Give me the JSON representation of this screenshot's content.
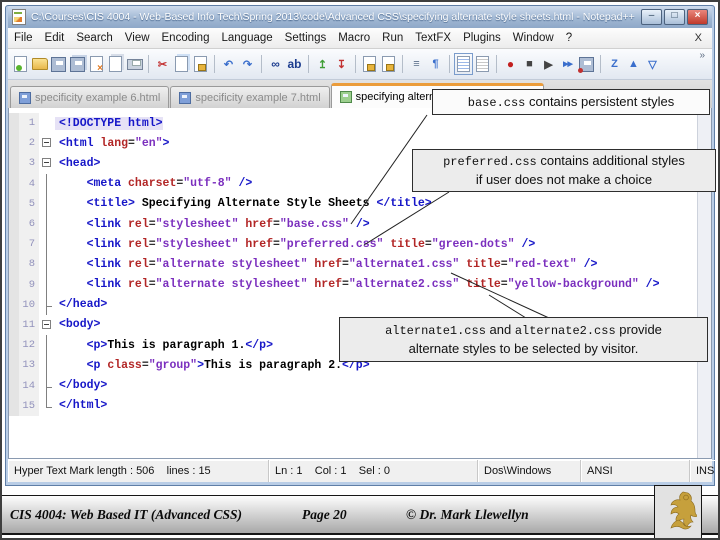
{
  "window": {
    "title": "C:\\Courses\\CIS 4004 - Web-Based Info Tech\\Spring 2013\\code\\Advanced CSS\\specifying alternate style sheets.html - Notepad++",
    "minimize": "–",
    "maximize": "□",
    "close": "×"
  },
  "menu": {
    "items": [
      "File",
      "Edit",
      "Search",
      "View",
      "Encoding",
      "Language",
      "Settings",
      "Macro",
      "Run",
      "TextFX",
      "Plugins",
      "Window",
      "?"
    ],
    "right_close": "X"
  },
  "toolbar": {
    "overflow": "»",
    "icons": [
      {
        "name": "new-file-icon",
        "cls": "i-page i-page-new"
      },
      {
        "name": "open-file-icon",
        "cls": "i-folder"
      },
      {
        "name": "save-icon",
        "cls": "i-disk"
      },
      {
        "name": "save-all-icon",
        "cls": "i-disk i-disk-all"
      },
      {
        "name": "close-file-icon",
        "cls": "i-page i-page-close"
      },
      {
        "name": "close-all-icon",
        "cls": "i-page i-page-close-all"
      },
      {
        "name": "print-icon",
        "cls": "i-print"
      },
      {
        "sep": true
      },
      {
        "name": "cut-icon",
        "cls": "i-glyph i-red",
        "glyph": "✂"
      },
      {
        "name": "copy-icon",
        "cls": "i-page i-page-copy"
      },
      {
        "name": "paste-icon",
        "cls": "i-page i-page-lock"
      },
      {
        "sep": true
      },
      {
        "name": "undo-icon",
        "cls": "i-glyph i-blue",
        "glyph": "↶"
      },
      {
        "name": "redo-icon",
        "cls": "i-glyph i-blue",
        "glyph": "↷"
      },
      {
        "sep": true
      },
      {
        "name": "find-icon",
        "cls": "i-glyph i-navy",
        "glyph": "∞"
      },
      {
        "name": "replace-icon",
        "cls": "i-glyph i-navy",
        "glyph": "ab"
      },
      {
        "sep": true
      },
      {
        "name": "prev-bookmark-icon",
        "cls": "i-glyph i-green",
        "glyph": "↥"
      },
      {
        "name": "next-bookmark-icon",
        "cls": "i-glyph i-red",
        "glyph": "↧"
      },
      {
        "sep": true
      },
      {
        "name": "readonly-doc-icon",
        "cls": "i-page i-page-lock"
      },
      {
        "name": "sync-scroll-icon",
        "cls": "i-page i-page-lock"
      },
      {
        "sep": true
      },
      {
        "name": "word-wrap-icon",
        "cls": "i-glyph i-slate",
        "glyph": "≡"
      },
      {
        "name": "show-symbols-icon",
        "cls": "i-glyph i-blue",
        "glyph": "¶"
      },
      {
        "sep": true
      },
      {
        "name": "document-map-icon",
        "cls": "i-page i-page-map i-selected"
      },
      {
        "name": "function-list-icon",
        "cls": "i-page i-page-func"
      },
      {
        "sep": true
      },
      {
        "name": "record-macro-icon",
        "cls": "i-glyph i-record",
        "glyph": "●"
      },
      {
        "name": "stop-macro-icon",
        "cls": "i-glyph i-dark",
        "glyph": "■"
      },
      {
        "name": "play-macro-icon",
        "cls": "i-glyph i-dark",
        "glyph": "▶"
      },
      {
        "name": "run-macro-multiple-icon",
        "cls": "i-glyph i-ff",
        "glyph": "▶▶"
      },
      {
        "name": "save-macro-icon",
        "cls": "i-disk i-disk-macro"
      },
      {
        "sep": true
      },
      {
        "name": "sort-icon",
        "cls": "i-glyph i-blue",
        "glyph": "Z"
      },
      {
        "name": "expand-icon",
        "cls": "i-glyph i-blue",
        "glyph": "▲"
      },
      {
        "name": "collapse-icon",
        "cls": "i-glyph i-blue",
        "glyph": "▽"
      }
    ]
  },
  "tabs": [
    {
      "label": "specificity example 6.html",
      "active": false
    },
    {
      "label": "specificity example 7.html",
      "active": false
    },
    {
      "label": "specifying alternate style sheets.html",
      "active": true
    }
  ],
  "editor": {
    "lines": [
      {
        "n": "1",
        "fold": "",
        "hl": true,
        "segs": [
          [
            "tag",
            "<!DOCTYPE html>"
          ]
        ]
      },
      {
        "n": "2",
        "fold": "box",
        "segs": [
          [
            "tag",
            "<html "
          ],
          [
            "attr",
            "lang"
          ],
          [
            "eq",
            "="
          ],
          [
            "val",
            "\"en\""
          ],
          [
            "tag",
            ">"
          ]
        ]
      },
      {
        "n": "3",
        "fold": "box",
        "segs": [
          [
            "tag",
            "<head>"
          ]
        ]
      },
      {
        "n": "4",
        "fold": "line",
        "segs": [
          [
            "pln",
            "    "
          ],
          [
            "tag",
            "<meta "
          ],
          [
            "attr",
            "charset"
          ],
          [
            "eq",
            "="
          ],
          [
            "val",
            "\"utf-8\""
          ],
          [
            "tag",
            " />"
          ]
        ]
      },
      {
        "n": "5",
        "fold": "line",
        "segs": [
          [
            "pln",
            "    "
          ],
          [
            "tag",
            "<title>"
          ],
          [
            "txt",
            " Specifying Alternate Style Sheets "
          ],
          [
            "tag",
            "</title>"
          ]
        ]
      },
      {
        "n": "6",
        "fold": "line",
        "segs": [
          [
            "pln",
            "    "
          ],
          [
            "tag",
            "<link "
          ],
          [
            "attr",
            "rel"
          ],
          [
            "eq",
            "="
          ],
          [
            "val",
            "\"stylesheet\""
          ],
          [
            "pln",
            " "
          ],
          [
            "attr",
            "href"
          ],
          [
            "eq",
            "="
          ],
          [
            "val",
            "\"base.css\""
          ],
          [
            "tag",
            " />"
          ]
        ]
      },
      {
        "n": "7",
        "fold": "line",
        "segs": [
          [
            "pln",
            "    "
          ],
          [
            "tag",
            "<link "
          ],
          [
            "attr",
            "rel"
          ],
          [
            "eq",
            "="
          ],
          [
            "val",
            "\"stylesheet\""
          ],
          [
            "pln",
            " "
          ],
          [
            "attr",
            "href"
          ],
          [
            "eq",
            "="
          ],
          [
            "val",
            "\"preferred.css\""
          ],
          [
            "pln",
            " "
          ],
          [
            "attr",
            "title"
          ],
          [
            "eq",
            "="
          ],
          [
            "val",
            "\"green-dots\""
          ],
          [
            "tag",
            " />"
          ]
        ]
      },
      {
        "n": "8",
        "fold": "line",
        "segs": [
          [
            "pln",
            "    "
          ],
          [
            "tag",
            "<link "
          ],
          [
            "attr",
            "rel"
          ],
          [
            "eq",
            "="
          ],
          [
            "val",
            "\"alternate stylesheet\""
          ],
          [
            "pln",
            " "
          ],
          [
            "attr",
            "href"
          ],
          [
            "eq",
            "="
          ],
          [
            "val",
            "\"alternate1.css\""
          ],
          [
            "pln",
            " "
          ],
          [
            "attr",
            "title"
          ],
          [
            "eq",
            "="
          ],
          [
            "val",
            "\"red-text\""
          ],
          [
            "tag",
            " />"
          ]
        ]
      },
      {
        "n": "9",
        "fold": "line",
        "segs": [
          [
            "pln",
            "    "
          ],
          [
            "tag",
            "<link "
          ],
          [
            "attr",
            "rel"
          ],
          [
            "eq",
            "="
          ],
          [
            "val",
            "\"alternate stylesheet\""
          ],
          [
            "pln",
            " "
          ],
          [
            "attr",
            "href"
          ],
          [
            "eq",
            "="
          ],
          [
            "val",
            "\"alternate2.css\""
          ],
          [
            "pln",
            " "
          ],
          [
            "attr",
            "title"
          ],
          [
            "eq",
            "="
          ],
          [
            "val",
            "\"yellow-background\""
          ],
          [
            "tag",
            " />"
          ]
        ]
      },
      {
        "n": "10",
        "fold": "endc",
        "segs": [
          [
            "tag",
            "</head>"
          ]
        ]
      },
      {
        "n": "11",
        "fold": "box",
        "segs": [
          [
            "tag",
            "<body>"
          ]
        ]
      },
      {
        "n": "12",
        "fold": "line",
        "segs": [
          [
            "pln",
            "    "
          ],
          [
            "tag",
            "<p>"
          ],
          [
            "txt",
            "This is paragraph 1."
          ],
          [
            "tag",
            "</p>"
          ]
        ]
      },
      {
        "n": "13",
        "fold": "line",
        "segs": [
          [
            "pln",
            "    "
          ],
          [
            "tag",
            "<p "
          ],
          [
            "attr",
            "class"
          ],
          [
            "eq",
            "="
          ],
          [
            "val",
            "\"group\""
          ],
          [
            "tag",
            ">"
          ],
          [
            "txt",
            "This is paragraph 2."
          ],
          [
            "tag",
            "</p>"
          ]
        ]
      },
      {
        "n": "14",
        "fold": "endc",
        "segs": [
          [
            "tag",
            "</body>"
          ]
        ]
      },
      {
        "n": "15",
        "fold": "end",
        "segs": [
          [
            "tag",
            "</html>"
          ]
        ]
      }
    ]
  },
  "callouts": [
    {
      "lines": [
        [
          [
            "m",
            "base.css"
          ],
          [
            "s",
            "  contains persistent styles"
          ]
        ]
      ]
    },
    {
      "lines": [
        [
          [
            "m",
            "preferred.css"
          ],
          [
            "s",
            " contains additional styles"
          ]
        ],
        [
          [
            "s",
            "if user does not make a choice"
          ]
        ]
      ]
    },
    {
      "lines": [
        [
          [
            "m",
            "alternate1.css"
          ],
          [
            "s",
            " and "
          ],
          [
            "m",
            "alternate2.css"
          ],
          [
            "s",
            " provide"
          ]
        ],
        [
          [
            "s",
            "alternate styles to be selected by visitor."
          ]
        ]
      ]
    }
  ],
  "statusbar": {
    "names": [
      "status-doc-info",
      "status-cursor-position",
      "status-line-ending",
      "status-encoding",
      "status-insert-mode"
    ],
    "fields": [
      "Hyper Text Mark length : 506    lines : 15",
      "Ln : 1    Col : 1    Sel : 0",
      "Dos\\Windows",
      "ANSI",
      "INS"
    ]
  },
  "footer": {
    "course": "CIS 4004: Web Based IT (Advanced CSS)",
    "page": "Page 20",
    "copyright": "© Dr. Mark Llewellyn"
  },
  "colors": {
    "active_tab_accent": "#EB9C3A",
    "close_button_red": "#BF3A2B",
    "code_tag": "#1616C8",
    "code_attribute": "#B22626",
    "code_value": "#7B2FBE",
    "code_text": "#000000",
    "current_line_highlight": "#E6E2F6",
    "logo_gold": "#C6A03C"
  }
}
